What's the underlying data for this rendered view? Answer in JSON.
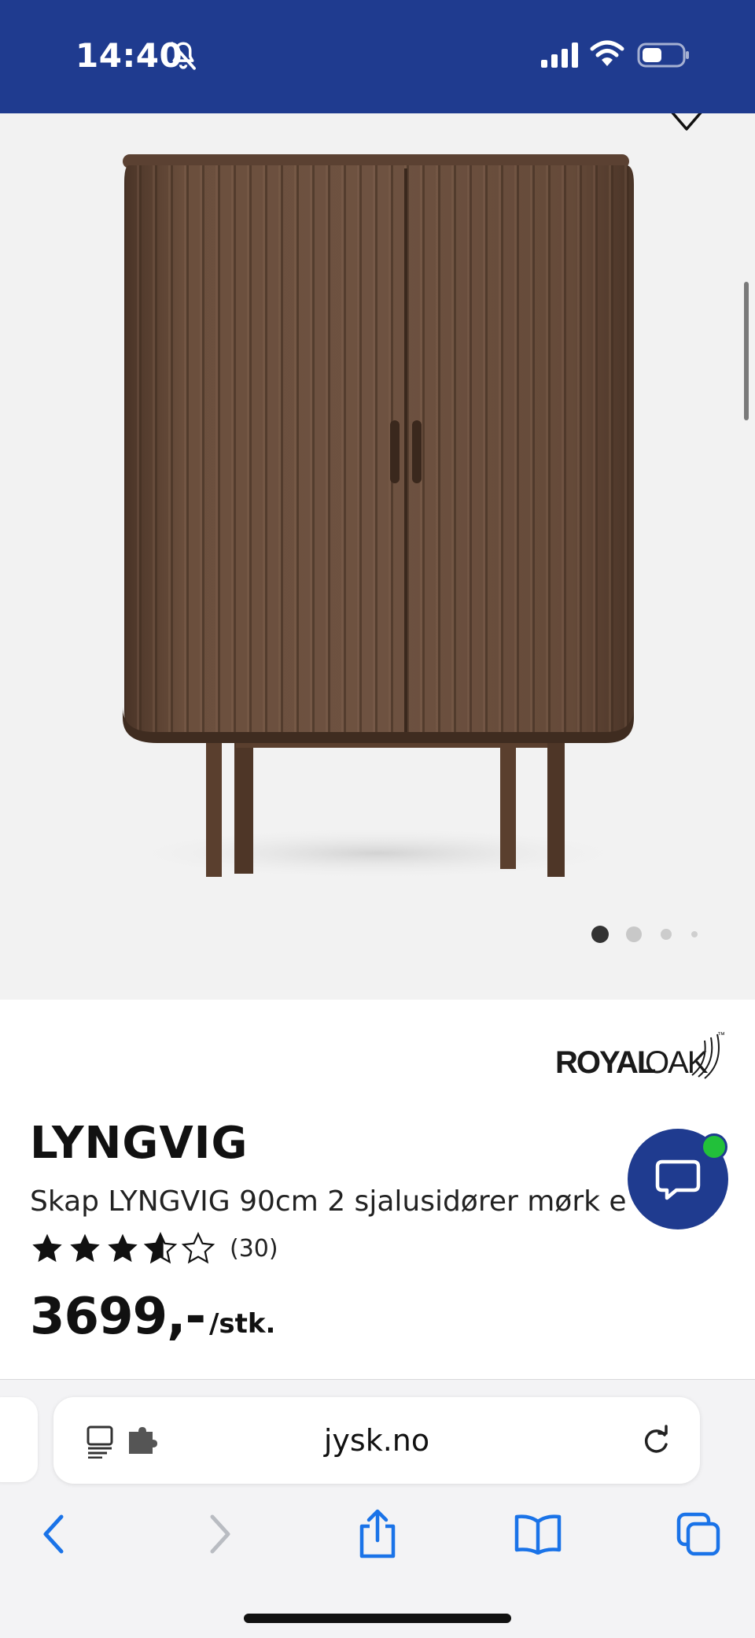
{
  "status_bar": {
    "time": "14:40",
    "icons": [
      "bell-slash-icon",
      "cellular-signal-icon",
      "wifi-icon",
      "battery-icon"
    ],
    "background": "#1f3b8f"
  },
  "product": {
    "gallery": {
      "image": "cabinet-product-photo",
      "page_count": 4,
      "current_page": 1
    },
    "brand": {
      "logo_text_bold": "ROYAL",
      "logo_text_light": "OAK",
      "trademark": "™"
    },
    "name": "LYNGVIG",
    "description": "Skap LYNGVIG 90cm 2 sjalusidører mørk eik",
    "rating": {
      "stars": 4,
      "max": 5,
      "count_label": "(30)"
    },
    "price": "3699,-",
    "price_unit": "/stk."
  },
  "chat": {
    "icon": "chat-bubble-icon",
    "online_color": "#22c03a"
  },
  "browser": {
    "url": "jysk.no",
    "toolbar": [
      "back-icon",
      "forward-icon",
      "share-icon",
      "bookmarks-icon",
      "tabs-icon"
    ],
    "accent": "#1a73e8"
  }
}
